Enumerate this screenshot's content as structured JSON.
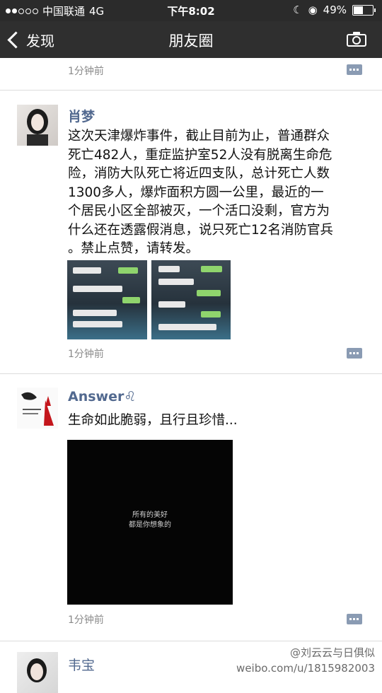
{
  "status_bar": {
    "carrier": "中国联通",
    "network": "4G",
    "time": "下午8:02",
    "battery": "49%",
    "battery_level": 0.49
  },
  "nav": {
    "back_label": "发现",
    "title": "朋友圈"
  },
  "top_post": {
    "time": "1分钟前"
  },
  "posts": [
    {
      "name": "肖梦",
      "text": [
        "这次天津爆炸事件，截止目前为止，普通群众",
        "死亡482人，重症监护室52人没有脱离生命危",
        "险，消防大队死亡将近四支队，总计死亡人数",
        "1300多人，爆炸面积方圆一公里，最近的一",
        "个居民小区全部被灭，一个活口没剩，官方为",
        "什么还在透露假消息，说只死亡12名消防官兵",
        "。禁止点赞，请转发。"
      ],
      "time": "1分钟前"
    },
    {
      "name": "Answer♌",
      "text": [
        "生命如此脆弱，且行且珍惜..."
      ],
      "image_text": [
        "所有的美好",
        "都是你想象的"
      ],
      "time": "1分钟前"
    },
    {
      "name": "韦宝"
    }
  ],
  "watermark": {
    "line1": "@刘云云与日俱似",
    "line2": "weibo.com/u/1815982003"
  }
}
